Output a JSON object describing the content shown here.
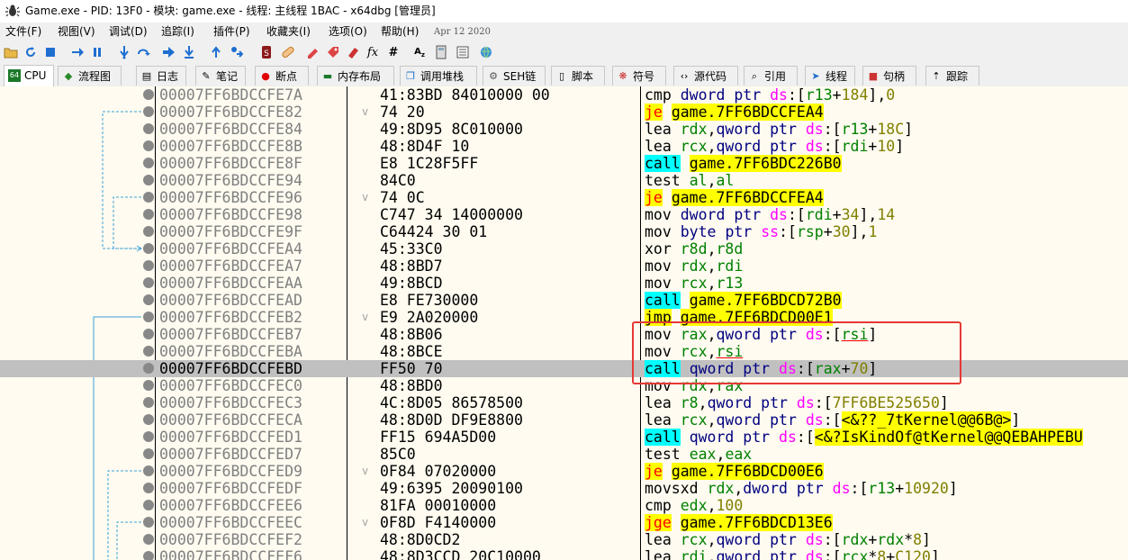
{
  "title": "Game.exe - PID: 13F0 - 模块: game.exe - 线程: 主线程 1BAC - x64dbg [管理员]",
  "menu": [
    "文件(F)",
    "视图(V)",
    "调试(D)",
    "追踪(I)",
    "插件(P)",
    "收藏夹(I)",
    "选项(O)",
    "帮助(H)"
  ],
  "date": "Apr 12 2020",
  "tabs": [
    {
      "label": "CPU",
      "icon": "cpu-icon"
    },
    {
      "label": "流程图",
      "icon": "graph-icon"
    },
    {
      "label": "日志",
      "icon": "log-icon"
    },
    {
      "label": "笔记",
      "icon": "notes-icon"
    },
    {
      "label": "断点",
      "icon": "breakpoint-icon"
    },
    {
      "label": "内存布局",
      "icon": "memory-icon"
    },
    {
      "label": "调用堆栈",
      "icon": "callstack-icon"
    },
    {
      "label": "SEH链",
      "icon": "seh-icon"
    },
    {
      "label": "脚本",
      "icon": "script-icon"
    },
    {
      "label": "符号",
      "icon": "symbols-icon"
    },
    {
      "label": "源代码",
      "icon": "source-icon"
    },
    {
      "label": "引用",
      "icon": "references-icon"
    },
    {
      "label": "线程",
      "icon": "threads-icon"
    },
    {
      "label": "句柄",
      "icon": "handles-icon"
    },
    {
      "label": "跟踪",
      "icon": "trace-icon"
    }
  ],
  "colors": {
    "call_bg": "#00ffff",
    "jmp_bg": "#ffff00",
    "selected_row": "#c0c0c0",
    "annotation_box": "#e53935"
  },
  "rows": [
    {
      "addr": "00007FF6BDCCFE7A",
      "bytes": "41:83BD 84010000 00",
      "asm": "cmp dword ptr ds:[r13+184],0"
    },
    {
      "addr": "00007FF6BDCCFE82",
      "bytes": "74 20",
      "asm": "je game.7FF6BDCCFEA4",
      "jmark": "v"
    },
    {
      "addr": "00007FF6BDCCFE84",
      "bytes": "49:8D95 8C010000",
      "asm": "lea rdx,qword ptr ds:[r13+18C]"
    },
    {
      "addr": "00007FF6BDCCFE8B",
      "bytes": "48:8D4F 10",
      "asm": "lea rcx,qword ptr ds:[rdi+10]"
    },
    {
      "addr": "00007FF6BDCCFE8F",
      "bytes": "E8 1C28F5FF",
      "asm": "call game.7FF6BDC226B0"
    },
    {
      "addr": "00007FF6BDCCFE94",
      "bytes": "84C0",
      "asm": "test al,al"
    },
    {
      "addr": "00007FF6BDCCFE96",
      "bytes": "74 0C",
      "asm": "je game.7FF6BDCCFEA4",
      "jmark": "v"
    },
    {
      "addr": "00007FF6BDCCFE98",
      "bytes": "C747 34 14000000",
      "asm": "mov dword ptr ds:[rdi+34],14"
    },
    {
      "addr": "00007FF6BDCCFE9F",
      "bytes": "C64424 30 01",
      "asm": "mov byte ptr ss:[rsp+30],1"
    },
    {
      "addr": "00007FF6BDCCFEA4",
      "bytes": "45:33C0",
      "asm": "xor r8d,r8d"
    },
    {
      "addr": "00007FF6BDCCFEA7",
      "bytes": "48:8BD7",
      "asm": "mov rdx,rdi"
    },
    {
      "addr": "00007FF6BDCCFEAA",
      "bytes": "49:8BCD",
      "asm": "mov rcx,r13"
    },
    {
      "addr": "00007FF6BDCCFEAD",
      "bytes": "E8 FE730000",
      "asm": "call game.7FF6BDCD72B0"
    },
    {
      "addr": "00007FF6BDCCFEB2",
      "bytes": "E9 2A020000",
      "asm": "jmp game.7FF6BDCD00E1",
      "jmark": "v"
    },
    {
      "addr": "00007FF6BDCCFEB7",
      "bytes": "48:8B06",
      "asm": "mov rax,qword ptr ds:[rsi]"
    },
    {
      "addr": "00007FF6BDCCFEBA",
      "bytes": "48:8BCE",
      "asm": "mov rcx,rsi"
    },
    {
      "addr": "00007FF6BDCCFEBD",
      "bytes": "FF50 70",
      "asm": "call qword ptr ds:[rax+70]",
      "selected": true
    },
    {
      "addr": "00007FF6BDCCFEC0",
      "bytes": "48:8BD0",
      "asm": "mov rdx,rax"
    },
    {
      "addr": "00007FF6BDCCFEC3",
      "bytes": "4C:8D05 86578500",
      "asm": "lea r8,qword ptr ds:[7FF6BE525650]"
    },
    {
      "addr": "00007FF6BDCCFECA",
      "bytes": "48:8D0D DF9E8800",
      "asm": "lea rcx,qword ptr ds:[<&??_7tKernel@@6B@>]"
    },
    {
      "addr": "00007FF6BDCCFED1",
      "bytes": "FF15 694A5D00",
      "asm": "call qword ptr ds:[<&?IsKindOf@tKernel@@QEBAHPEBU"
    },
    {
      "addr": "00007FF6BDCCFED7",
      "bytes": "85C0",
      "asm": "test eax,eax"
    },
    {
      "addr": "00007FF6BDCCFED9",
      "bytes": "0F84 07020000",
      "asm": "je game.7FF6BDCD00E6",
      "jmark": "v"
    },
    {
      "addr": "00007FF6BDCCFEDF",
      "bytes": "49:6395 20090100",
      "asm": "movsxd rdx,dword ptr ds:[r13+10920]"
    },
    {
      "addr": "00007FF6BDCCFEE6",
      "bytes": "81FA 00010000",
      "asm": "cmp edx,100"
    },
    {
      "addr": "00007FF6BDCCFEEC",
      "bytes": "0F8D F4140000",
      "asm": "jge game.7FF6BDCD13E6",
      "jmark": "v"
    },
    {
      "addr": "00007FF6BDCCFEF2",
      "bytes": "48:8D0CD2",
      "asm": "lea rcx,qword ptr ds:[rdx+rdx*8]"
    },
    {
      "addr": "00007FF6BDCCFEF6",
      "bytes": "48:8D3CCD 20C10000",
      "asm": "lea rdi,qword ptr ds:[rcx*8+C120]"
    }
  ]
}
